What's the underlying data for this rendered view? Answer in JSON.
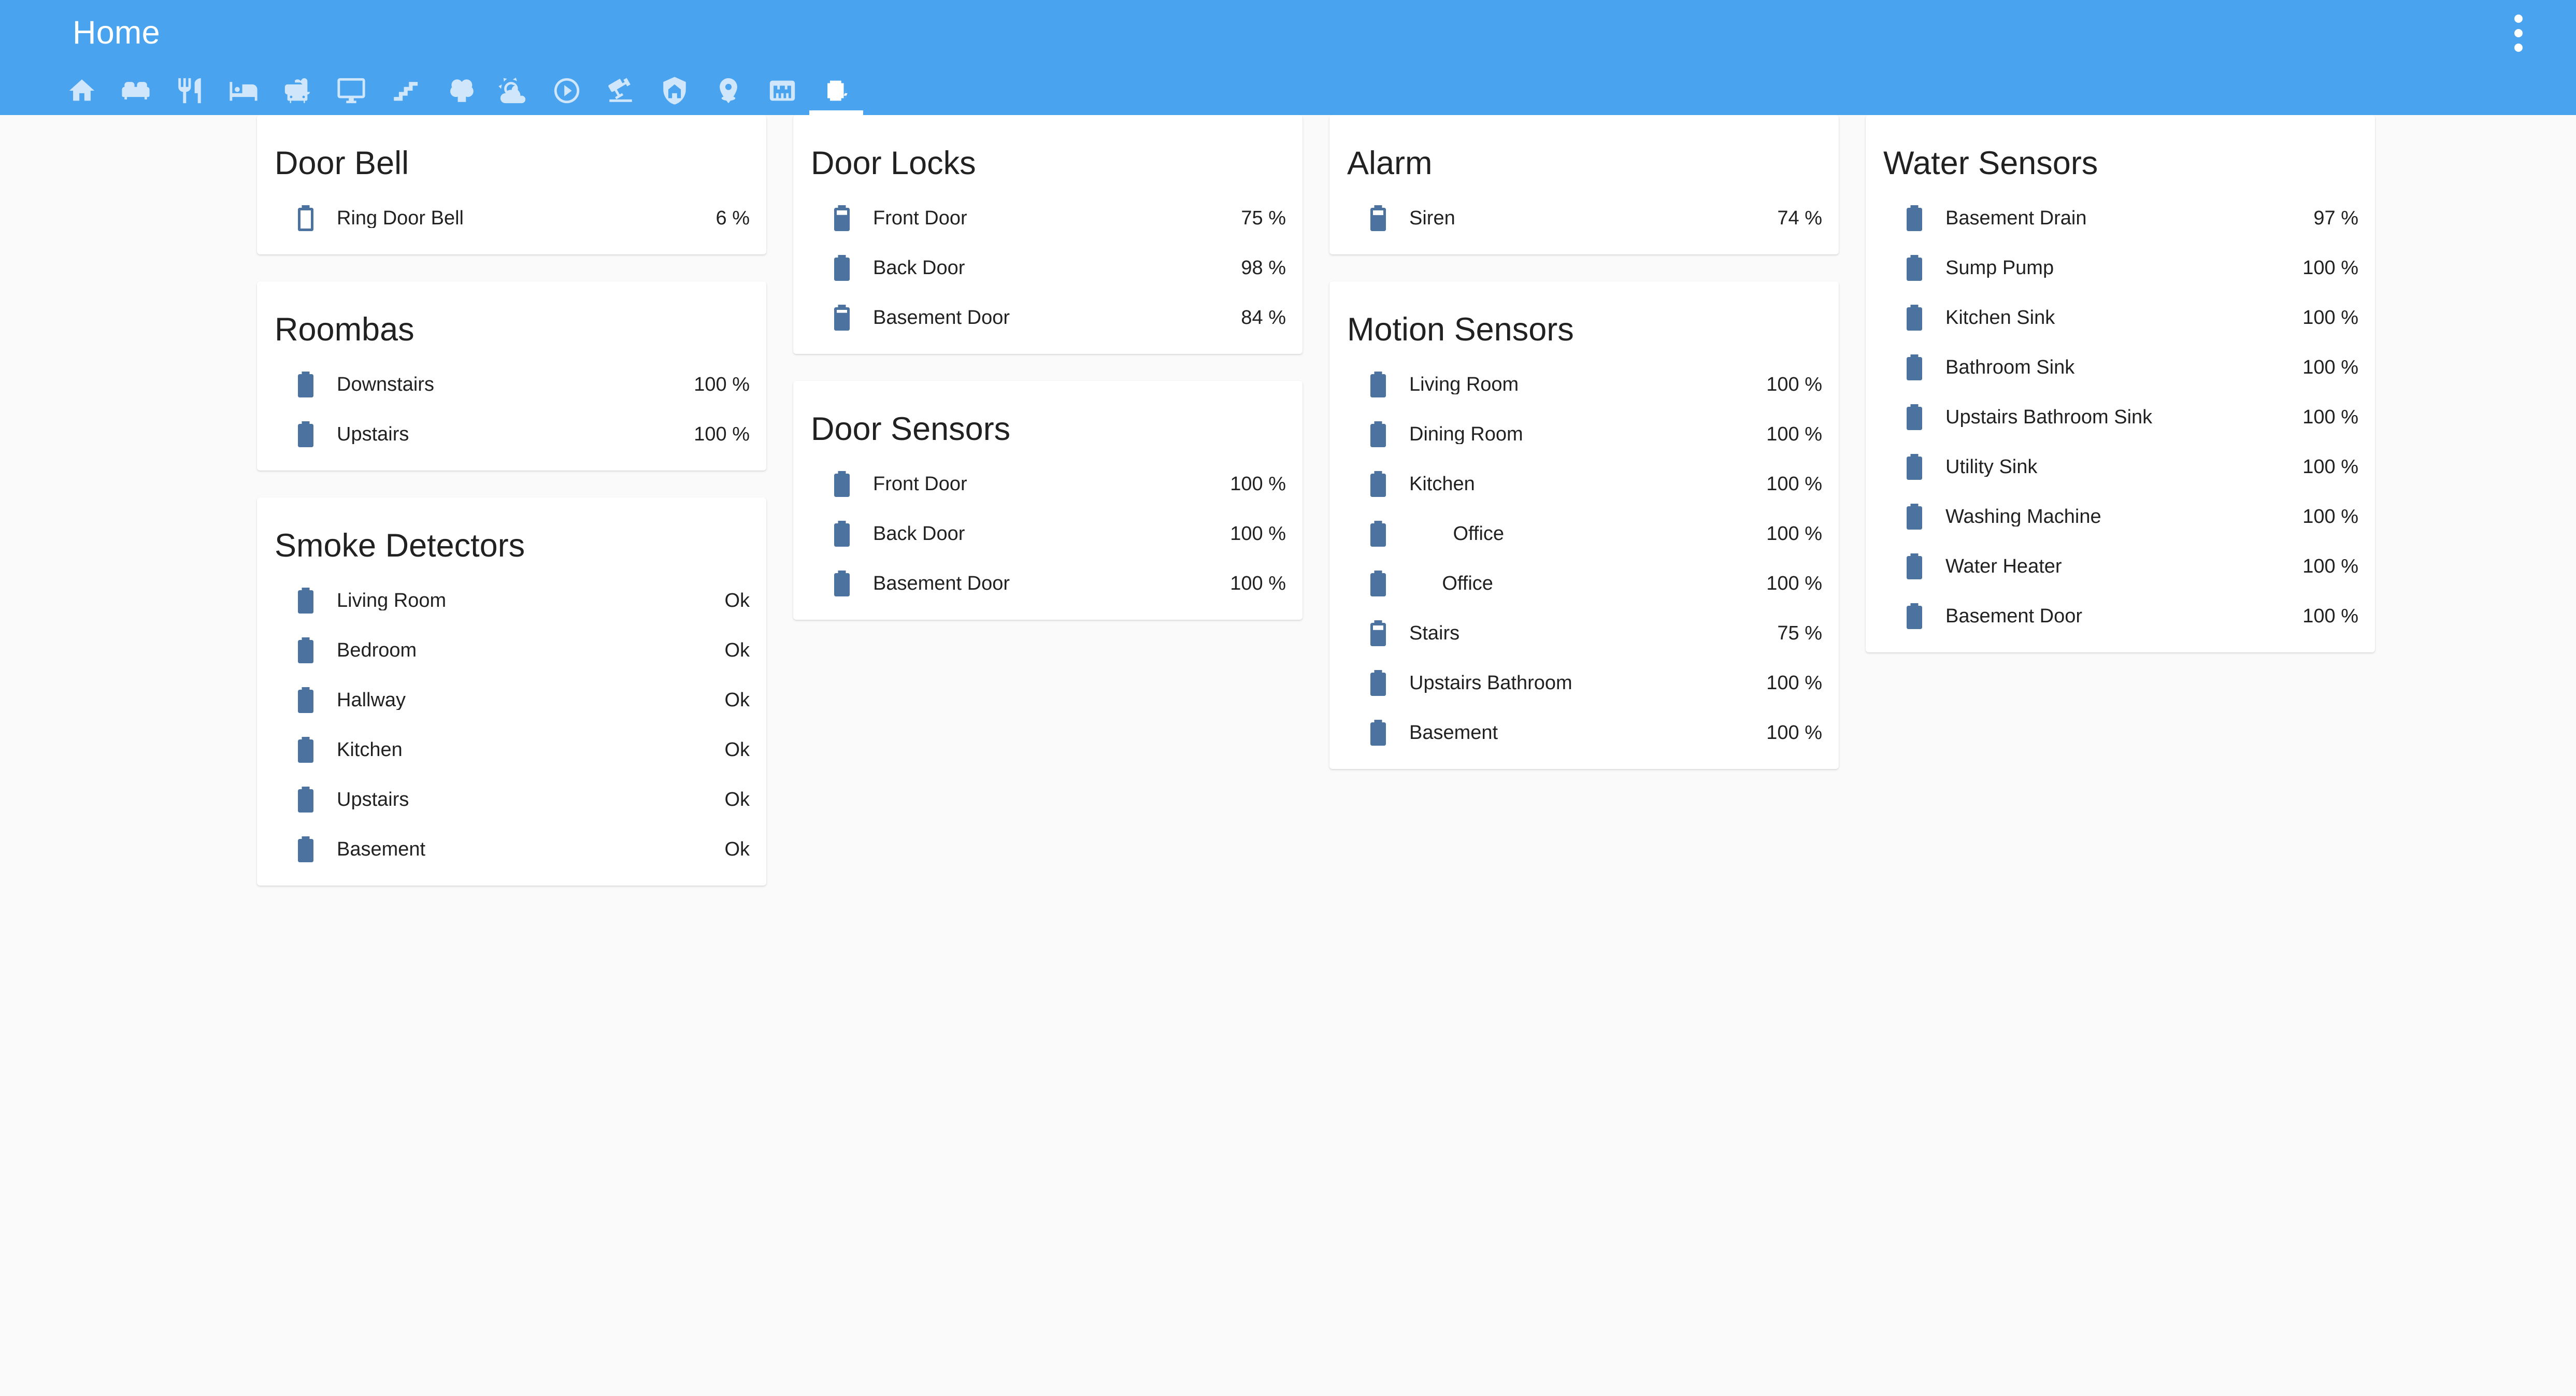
{
  "header": {
    "title": "Home",
    "overflow_menu_icon": "dots-vertical-icon",
    "background_color": "#4aa3ef",
    "tabs": [
      {
        "icon": "home-icon",
        "active": false
      },
      {
        "icon": "sofa-icon",
        "active": false
      },
      {
        "icon": "silverware-fork-knife-icon",
        "active": false
      },
      {
        "icon": "bed-icon",
        "active": false
      },
      {
        "icon": "bathtub-icon",
        "active": false
      },
      {
        "icon": "monitor-icon",
        "active": false
      },
      {
        "icon": "stairs-icon",
        "active": false
      },
      {
        "icon": "tree-icon",
        "active": false
      },
      {
        "icon": "weather-partly-cloudy-icon",
        "active": false
      },
      {
        "icon": "play-circle-outline-icon",
        "active": false
      },
      {
        "icon": "cctv-camera-icon",
        "active": false
      },
      {
        "icon": "shield-home-icon",
        "active": false
      },
      {
        "icon": "map-marker-icon",
        "active": false
      },
      {
        "icon": "ethernet-icon",
        "active": false
      },
      {
        "icon": "battery-charging-icon",
        "active": true
      }
    ]
  },
  "theme": {
    "page_background": "#fafafa",
    "card_background": "#ffffff",
    "battery_icon_color": "#4c73a0",
    "text_color": "#212121",
    "tab_inactive_color": "#cfe6fb",
    "tab_active_color": "#ffffff"
  },
  "columns": [
    {
      "cards": [
        {
          "title": "Door Bell",
          "rows": [
            {
              "icon": "battery-outline-icon",
              "level": 6,
              "name": "Ring Door Bell",
              "state": "6 %"
            }
          ]
        },
        {
          "title": "Roombas",
          "rows": [
            {
              "icon": "battery-icon",
              "level": 100,
              "name": "Downstairs",
              "state": "100 %"
            },
            {
              "icon": "battery-icon",
              "level": 100,
              "name": "Upstairs",
              "state": "100 %"
            }
          ]
        },
        {
          "title": "Smoke Detectors",
          "rows": [
            {
              "icon": "battery-icon",
              "level": 100,
              "name": "Living Room",
              "state": "Ok"
            },
            {
              "icon": "battery-icon",
              "level": 100,
              "name": "Bedroom",
              "state": "Ok"
            },
            {
              "icon": "battery-icon",
              "level": 100,
              "name": "Hallway",
              "state": "Ok"
            },
            {
              "icon": "battery-icon",
              "level": 100,
              "name": "Kitchen",
              "state": "Ok"
            },
            {
              "icon": "battery-icon",
              "level": 100,
              "name": "Upstairs",
              "state": "Ok"
            },
            {
              "icon": "battery-icon",
              "level": 100,
              "name": "Basement",
              "state": "Ok"
            }
          ]
        }
      ]
    },
    {
      "cards": [
        {
          "title": "Door Locks",
          "rows": [
            {
              "icon": "battery-70-icon",
              "level": 75,
              "name": "Front Door",
              "state": "75 %"
            },
            {
              "icon": "battery-icon",
              "level": 98,
              "name": "Back Door",
              "state": "98 %"
            },
            {
              "icon": "battery-80-icon",
              "level": 84,
              "name": "Basement Door",
              "state": "84 %"
            }
          ]
        },
        {
          "title": "Door Sensors",
          "rows": [
            {
              "icon": "battery-icon",
              "level": 100,
              "name": "Front Door",
              "state": "100 %"
            },
            {
              "icon": "battery-icon",
              "level": 100,
              "name": "Back Door",
              "state": "100 %"
            },
            {
              "icon": "battery-icon",
              "level": 100,
              "name": "Basement Door",
              "state": "100 %"
            }
          ]
        }
      ]
    },
    {
      "cards": [
        {
          "title": "Alarm",
          "rows": [
            {
              "icon": "battery-70-icon",
              "level": 74,
              "name": "Siren",
              "state": "74 %"
            }
          ]
        },
        {
          "title": "Motion Sensors",
          "rows": [
            {
              "icon": "battery-icon",
              "level": 100,
              "name": "Living Room",
              "state": "100 %"
            },
            {
              "icon": "battery-icon",
              "level": 100,
              "name": "Dining Room",
              "state": "100 %"
            },
            {
              "icon": "battery-icon",
              "level": 100,
              "name": "Kitchen",
              "state": "100 %"
            },
            {
              "icon": "battery-icon",
              "level": 100,
              "name": "        Office",
              "state": "100 %"
            },
            {
              "icon": "battery-icon",
              "level": 100,
              "name": "      Office",
              "state": "100 %"
            },
            {
              "icon": "battery-70-icon",
              "level": 75,
              "name": "Stairs",
              "state": "75 %"
            },
            {
              "icon": "battery-icon",
              "level": 100,
              "name": "Upstairs Bathroom",
              "state": "100 %"
            },
            {
              "icon": "battery-icon",
              "level": 100,
              "name": "Basement",
              "state": "100 %"
            }
          ]
        }
      ]
    },
    {
      "cards": [
        {
          "title": "Water Sensors",
          "rows": [
            {
              "icon": "battery-icon",
              "level": 97,
              "name": "Basement Drain",
              "state": "97 %"
            },
            {
              "icon": "battery-icon",
              "level": 100,
              "name": "Sump Pump",
              "state": "100 %"
            },
            {
              "icon": "battery-icon",
              "level": 100,
              "name": "Kitchen Sink",
              "state": "100 %"
            },
            {
              "icon": "battery-icon",
              "level": 100,
              "name": "Bathroom Sink",
              "state": "100 %"
            },
            {
              "icon": "battery-icon",
              "level": 100,
              "name": "Upstairs Bathroom Sink",
              "state": "100 %"
            },
            {
              "icon": "battery-icon",
              "level": 100,
              "name": "Utility Sink",
              "state": "100 %"
            },
            {
              "icon": "battery-icon",
              "level": 100,
              "name": "Washing Machine",
              "state": "100 %"
            },
            {
              "icon": "battery-icon",
              "level": 100,
              "name": "Water Heater",
              "state": "100 %"
            },
            {
              "icon": "battery-icon",
              "level": 100,
              "name": "Basement Door",
              "state": "100 %"
            }
          ]
        }
      ]
    }
  ]
}
